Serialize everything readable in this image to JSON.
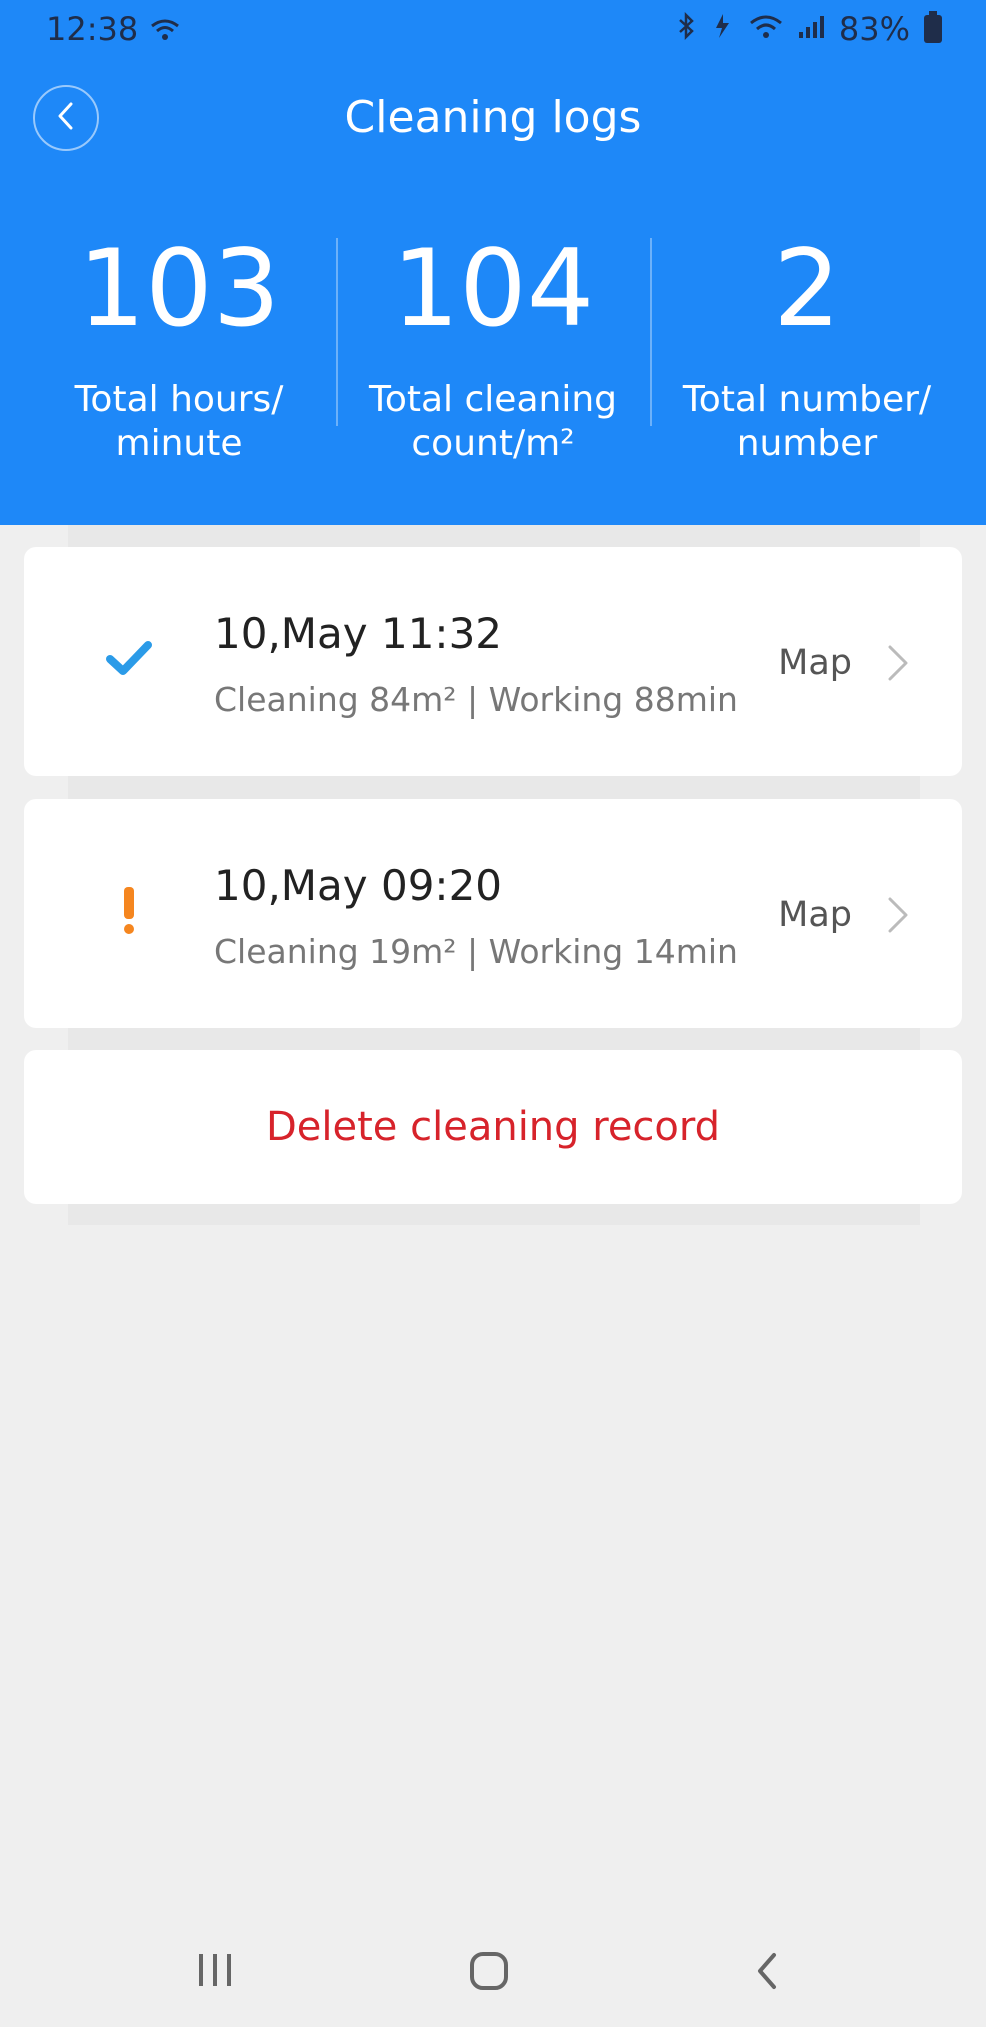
{
  "status_bar": {
    "time": "12:38",
    "battery": "83%",
    "icons": [
      "wifi-icon",
      "bluetooth-icon",
      "charging-icon",
      "wifi-icon",
      "signal-icon",
      "battery-icon"
    ]
  },
  "header": {
    "title": "Cleaning logs",
    "back_icon": "chevron-left-icon",
    "background_color": "#1e88f8"
  },
  "stats": [
    {
      "value": "103",
      "label_line1": "Total hours/",
      "label_line2": "minute"
    },
    {
      "value": "104",
      "label_line1": "Total cleaning",
      "label_line2": "count/m²"
    },
    {
      "value": "2",
      "label_line1": "Total number/",
      "label_line2": "number"
    }
  ],
  "records": [
    {
      "status": "completed",
      "status_icon": "checkmark-icon",
      "status_color": "#2b9be8",
      "date": "10,May 11:32",
      "detail": "Cleaning 84m² | Working 88min",
      "map_label": "Map"
    },
    {
      "status": "warning",
      "status_icon": "exclamation-icon",
      "status_color": "#f5861f",
      "date": "10,May 09:20",
      "detail": "Cleaning 19m² | Working 14min",
      "map_label": "Map"
    }
  ],
  "delete_label": "Delete cleaning record",
  "delete_color": "#d7232b",
  "system_nav": [
    "recent-apps-icon",
    "home-icon",
    "back-icon"
  ]
}
